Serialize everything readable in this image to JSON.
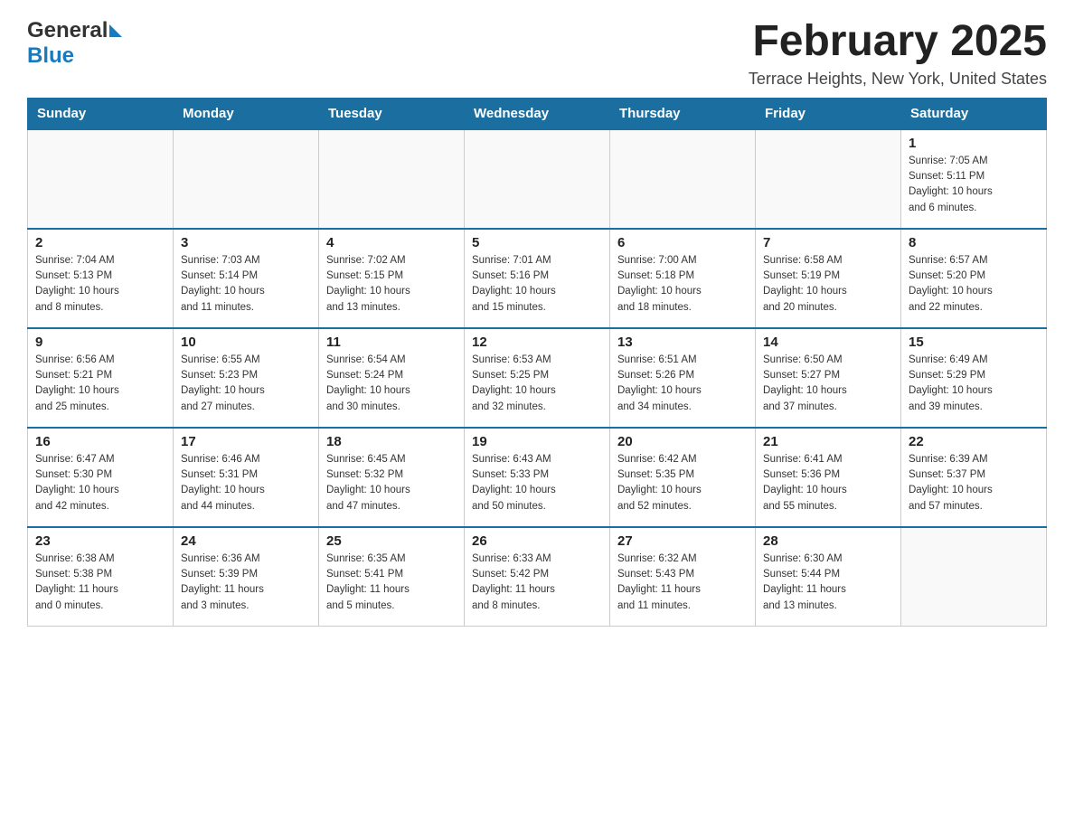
{
  "header": {
    "logo_general": "General",
    "logo_blue": "Blue",
    "month_title": "February 2025",
    "location": "Terrace Heights, New York, United States"
  },
  "weekdays": [
    "Sunday",
    "Monday",
    "Tuesday",
    "Wednesday",
    "Thursday",
    "Friday",
    "Saturday"
  ],
  "weeks": [
    [
      {
        "day": "",
        "info": ""
      },
      {
        "day": "",
        "info": ""
      },
      {
        "day": "",
        "info": ""
      },
      {
        "day": "",
        "info": ""
      },
      {
        "day": "",
        "info": ""
      },
      {
        "day": "",
        "info": ""
      },
      {
        "day": "1",
        "info": "Sunrise: 7:05 AM\nSunset: 5:11 PM\nDaylight: 10 hours\nand 6 minutes."
      }
    ],
    [
      {
        "day": "2",
        "info": "Sunrise: 7:04 AM\nSunset: 5:13 PM\nDaylight: 10 hours\nand 8 minutes."
      },
      {
        "day": "3",
        "info": "Sunrise: 7:03 AM\nSunset: 5:14 PM\nDaylight: 10 hours\nand 11 minutes."
      },
      {
        "day": "4",
        "info": "Sunrise: 7:02 AM\nSunset: 5:15 PM\nDaylight: 10 hours\nand 13 minutes."
      },
      {
        "day": "5",
        "info": "Sunrise: 7:01 AM\nSunset: 5:16 PM\nDaylight: 10 hours\nand 15 minutes."
      },
      {
        "day": "6",
        "info": "Sunrise: 7:00 AM\nSunset: 5:18 PM\nDaylight: 10 hours\nand 18 minutes."
      },
      {
        "day": "7",
        "info": "Sunrise: 6:58 AM\nSunset: 5:19 PM\nDaylight: 10 hours\nand 20 minutes."
      },
      {
        "day": "8",
        "info": "Sunrise: 6:57 AM\nSunset: 5:20 PM\nDaylight: 10 hours\nand 22 minutes."
      }
    ],
    [
      {
        "day": "9",
        "info": "Sunrise: 6:56 AM\nSunset: 5:21 PM\nDaylight: 10 hours\nand 25 minutes."
      },
      {
        "day": "10",
        "info": "Sunrise: 6:55 AM\nSunset: 5:23 PM\nDaylight: 10 hours\nand 27 minutes."
      },
      {
        "day": "11",
        "info": "Sunrise: 6:54 AM\nSunset: 5:24 PM\nDaylight: 10 hours\nand 30 minutes."
      },
      {
        "day": "12",
        "info": "Sunrise: 6:53 AM\nSunset: 5:25 PM\nDaylight: 10 hours\nand 32 minutes."
      },
      {
        "day": "13",
        "info": "Sunrise: 6:51 AM\nSunset: 5:26 PM\nDaylight: 10 hours\nand 34 minutes."
      },
      {
        "day": "14",
        "info": "Sunrise: 6:50 AM\nSunset: 5:27 PM\nDaylight: 10 hours\nand 37 minutes."
      },
      {
        "day": "15",
        "info": "Sunrise: 6:49 AM\nSunset: 5:29 PM\nDaylight: 10 hours\nand 39 minutes."
      }
    ],
    [
      {
        "day": "16",
        "info": "Sunrise: 6:47 AM\nSunset: 5:30 PM\nDaylight: 10 hours\nand 42 minutes."
      },
      {
        "day": "17",
        "info": "Sunrise: 6:46 AM\nSunset: 5:31 PM\nDaylight: 10 hours\nand 44 minutes."
      },
      {
        "day": "18",
        "info": "Sunrise: 6:45 AM\nSunset: 5:32 PM\nDaylight: 10 hours\nand 47 minutes."
      },
      {
        "day": "19",
        "info": "Sunrise: 6:43 AM\nSunset: 5:33 PM\nDaylight: 10 hours\nand 50 minutes."
      },
      {
        "day": "20",
        "info": "Sunrise: 6:42 AM\nSunset: 5:35 PM\nDaylight: 10 hours\nand 52 minutes."
      },
      {
        "day": "21",
        "info": "Sunrise: 6:41 AM\nSunset: 5:36 PM\nDaylight: 10 hours\nand 55 minutes."
      },
      {
        "day": "22",
        "info": "Sunrise: 6:39 AM\nSunset: 5:37 PM\nDaylight: 10 hours\nand 57 minutes."
      }
    ],
    [
      {
        "day": "23",
        "info": "Sunrise: 6:38 AM\nSunset: 5:38 PM\nDaylight: 11 hours\nand 0 minutes."
      },
      {
        "day": "24",
        "info": "Sunrise: 6:36 AM\nSunset: 5:39 PM\nDaylight: 11 hours\nand 3 minutes."
      },
      {
        "day": "25",
        "info": "Sunrise: 6:35 AM\nSunset: 5:41 PM\nDaylight: 11 hours\nand 5 minutes."
      },
      {
        "day": "26",
        "info": "Sunrise: 6:33 AM\nSunset: 5:42 PM\nDaylight: 11 hours\nand 8 minutes."
      },
      {
        "day": "27",
        "info": "Sunrise: 6:32 AM\nSunset: 5:43 PM\nDaylight: 11 hours\nand 11 minutes."
      },
      {
        "day": "28",
        "info": "Sunrise: 6:30 AM\nSunset: 5:44 PM\nDaylight: 11 hours\nand 13 minutes."
      },
      {
        "day": "",
        "info": ""
      }
    ]
  ]
}
